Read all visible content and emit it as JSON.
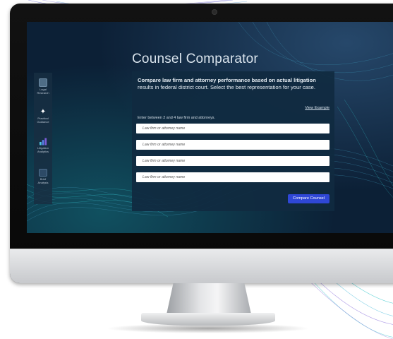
{
  "app": {
    "title": "Counsel Comparator"
  },
  "sidebar": {
    "items": [
      {
        "label_line1": "Legal",
        "label_line2": "Research",
        "icon": "legal-research-icon"
      },
      {
        "label_line1": "Practical",
        "label_line2": "Guidance",
        "icon": "compass-icon"
      },
      {
        "label_line1": "Litigation",
        "label_line2": "Analytics",
        "icon": "bar-chart-icon"
      },
      {
        "label_line1": "Brief",
        "label_line2": "Analysis",
        "icon": "document-icon"
      }
    ]
  },
  "panel": {
    "intro_bold": "Compare law firm and attorney performance based on actual litigation",
    "intro_rest": "results in federal district court. Select the best representation for your case.",
    "view_example": "View Example",
    "instruction": "Enter between 2 and 4 law firm and attorneys.",
    "inputs": [
      {
        "placeholder": "Law firm or attorney name"
      },
      {
        "placeholder": "Law firm or attorney name"
      },
      {
        "placeholder": "Law firm or attorney name"
      },
      {
        "placeholder": "Law firm or attorney name"
      }
    ],
    "submit_label": "Compare Counsel"
  },
  "colors": {
    "screen_bg": "#0c2036",
    "panel_bg": "#102a40",
    "accent_button": "#2f47d6",
    "wave_teal": "#2ec4c9",
    "wave_purple": "#7a5cd6"
  }
}
